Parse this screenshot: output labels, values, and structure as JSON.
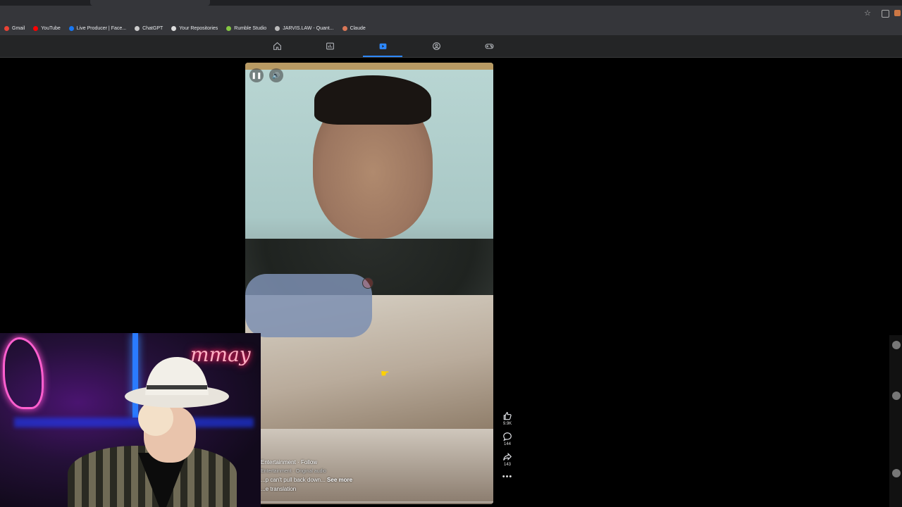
{
  "browser": {
    "bookmarks": [
      {
        "label": "Gmail",
        "color": "#ea4335"
      },
      {
        "label": "YouTube",
        "color": "#ff0000"
      },
      {
        "label": "Live Producer | Face...",
        "color": "#1877f2"
      },
      {
        "label": "ChatGPT",
        "color": "#cccccc"
      },
      {
        "label": "Your Repositories",
        "color": "#dddddd"
      },
      {
        "label": "Rumble Studio",
        "color": "#85c742"
      },
      {
        "label": "JARVIS.LAW - Quant...",
        "color": "#bbbbbb"
      },
      {
        "label": "Claude",
        "color": "#d97757"
      }
    ]
  },
  "nav": {
    "items": [
      {
        "icon": "home-icon"
      },
      {
        "icon": "marketplace-icon"
      },
      {
        "icon": "video-icon",
        "active": true
      },
      {
        "icon": "groups-icon"
      },
      {
        "icon": "gaming-icon"
      }
    ],
    "accent": "#2d88ff"
  },
  "reel": {
    "author": "Entertainment",
    "follow_label": "Follow",
    "audio": "Entertainment · Original audio",
    "caption": "...p can't pull back down...",
    "see_more": "See more",
    "translation": "...e translation",
    "likes": "9.9K",
    "comments": "144",
    "shares": "143",
    "more": "•••"
  },
  "webcam": {
    "neon_sign": "mmay"
  }
}
